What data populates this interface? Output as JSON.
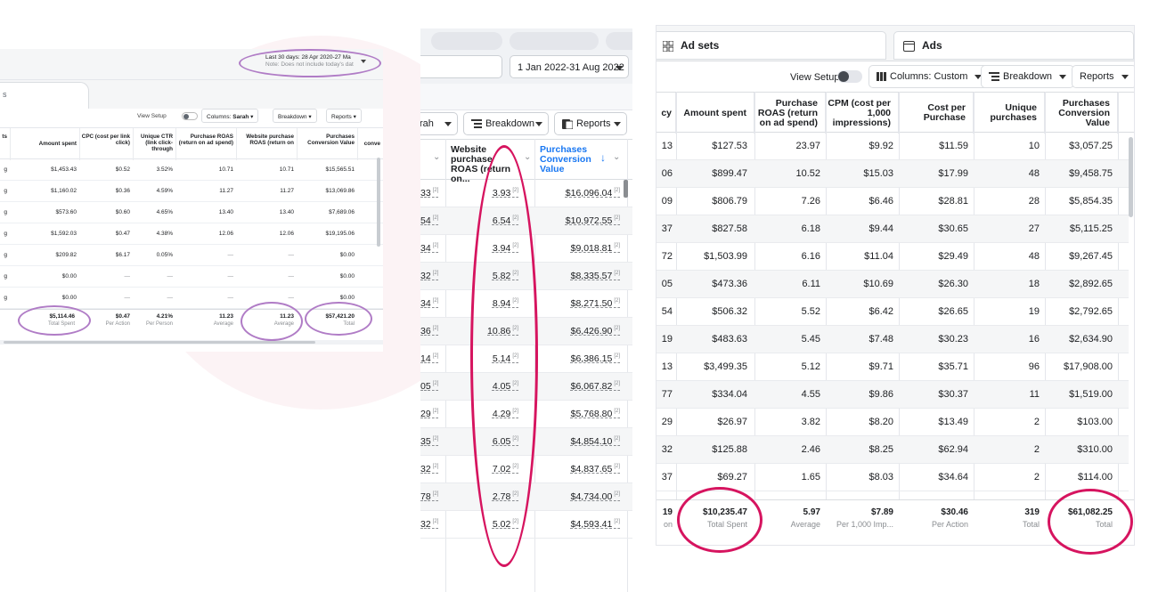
{
  "colors": {
    "highlight_purple": "#b07cc6",
    "highlight_pink": "#d6145f",
    "link_blue": "#1877f2",
    "watermark": "#fbeff2"
  },
  "icons": [
    "toggle-icon",
    "caret-down-icon",
    "columns-icon",
    "breakdown-icon",
    "reports-icon",
    "adsets-icon",
    "ads-icon",
    "sort-desc-icon",
    "info-icon"
  ],
  "panel1": {
    "date_range": "Last 30 days: 28 Apr 2020-27 Ma",
    "date_note": "Note: Does not include today's dat",
    "tab_label": "s",
    "toolbar": {
      "view_setup": "View Setup",
      "columns_prefix": "Columns: ",
      "columns_value": "Sarah",
      "breakdown": "Breakdown",
      "reports": "Reports"
    },
    "headers": [
      "ts",
      "Amount spent",
      "CPC (cost per link click)",
      "Unique CTR (link click-through",
      "Purchase ROAS (return on ad spend)",
      "Website purchase ROAS (return on",
      "Purchases Conversion Value",
      "conve"
    ],
    "rows": [
      {
        "c0": "g",
        "amount": "$1,453.43",
        "cpc": "$0.52",
        "ctr": "3.52%",
        "roas": "10.71",
        "wroas": "10.71",
        "pcv": "$15,565.51"
      },
      {
        "c0": "g",
        "amount": "$1,160.02",
        "cpc": "$0.36",
        "ctr": "4.59%",
        "roas": "11.27",
        "wroas": "11.27",
        "pcv": "$13,069.86"
      },
      {
        "c0": "g",
        "amount": "$573.60",
        "cpc": "$0.60",
        "ctr": "4.65%",
        "roas": "13.40",
        "wroas": "13.40",
        "pcv": "$7,689.06"
      },
      {
        "c0": "g",
        "amount": "$1,592.03",
        "cpc": "$0.47",
        "ctr": "4.38%",
        "roas": "12.06",
        "wroas": "12.06",
        "pcv": "$19,195.06"
      },
      {
        "c0": "g",
        "amount": "$209.82",
        "cpc": "$6.17",
        "ctr": "0.05%",
        "roas": "—",
        "wroas": "—",
        "pcv": "$0.00"
      },
      {
        "c0": "g",
        "amount": "$0.00",
        "cpc": "—",
        "ctr": "—",
        "roas": "—",
        "wroas": "—",
        "pcv": "$0.00"
      },
      {
        "c0": "g",
        "amount": "$0.00",
        "cpc": "—",
        "ctr": "—",
        "roas": "—",
        "wroas": "—",
        "pcv": "$0.00"
      }
    ],
    "totals": {
      "amount": "$5,114.46",
      "amount_label": "Total Spent",
      "cpc": "$0.47",
      "cpc_label": "Per Action",
      "ctr": "4.21%",
      "ctr_label": "Per Person",
      "roas": "11.23",
      "roas_label": "Average",
      "wroas": "11.23",
      "wroas_label": "Average",
      "pcv": "$57,421.20",
      "pcv_label": "Total"
    }
  },
  "panel2": {
    "date_range": "1 Jan 2022-31 Aug 2022",
    "toolbar": {
      "columns_partial": "rah",
      "breakdown": "Breakdown",
      "reports": "Reports"
    },
    "headers": {
      "website_roas": "Website purchase ROAS (return on...",
      "pcv": "Purchases Conversion Value"
    },
    "rows": [
      {
        "left": "33",
        "roas": "3.93",
        "pcv": "$16,096.04"
      },
      {
        "left": "54",
        "roas": "6.54",
        "pcv": "$10,972.55"
      },
      {
        "left": "34",
        "roas": "3.94",
        "pcv": "$9,018.81"
      },
      {
        "left": "32",
        "roas": "5.82",
        "pcv": "$8,335.57"
      },
      {
        "left": "34",
        "roas": "8.94",
        "pcv": "$8,271.50"
      },
      {
        "left": "36",
        "roas": "10.86",
        "pcv": "$6,426.90"
      },
      {
        "left": "14",
        "roas": "5.14",
        "pcv": "$6,386.15"
      },
      {
        "left": "05",
        "roas": "4.05",
        "pcv": "$6,067.82"
      },
      {
        "left": "29",
        "roas": "4.29",
        "pcv": "$5,768.80"
      },
      {
        "left": "35",
        "roas": "6.05",
        "pcv": "$4,854.10"
      },
      {
        "left": "32",
        "roas": "7.02",
        "pcv": "$4,837.65"
      },
      {
        "left": "78",
        "roas": "2.78",
        "pcv": "$4,734.00"
      },
      {
        "left": "32",
        "roas": "5.02",
        "pcv": "$4,593.41"
      }
    ],
    "sup": "[2]"
  },
  "panel3": {
    "tabs": {
      "adsets": "Ad sets",
      "ads": "Ads"
    },
    "toolbar": {
      "view_setup": "View Setup",
      "columns": "Columns: Custom",
      "breakdown": "Breakdown",
      "reports": "Reports"
    },
    "headers": {
      "c0": "cy",
      "amount": "Amount spent",
      "roas": "Purchase ROAS (return on ad spend)",
      "cpm": "CPM (cost per 1,000 impressions)",
      "cpp": "Cost per Purchase",
      "uniq": "Unique purchases",
      "pcv": "Purchases Conversion Value"
    },
    "rows": [
      {
        "c0": "13",
        "amount": "$127.53",
        "roas": "23.97",
        "cpm": "$9.92",
        "cpp": "$11.59",
        "uniq": "10",
        "pcv": "$3,057.25"
      },
      {
        "c0": "06",
        "amount": "$899.47",
        "roas": "10.52",
        "cpm": "$15.03",
        "cpp": "$17.99",
        "uniq": "48",
        "pcv": "$9,458.75"
      },
      {
        "c0": "09",
        "amount": "$806.79",
        "roas": "7.26",
        "cpm": "$6.46",
        "cpp": "$28.81",
        "uniq": "28",
        "pcv": "$5,854.35"
      },
      {
        "c0": "37",
        "amount": "$827.58",
        "roas": "6.18",
        "cpm": "$9.44",
        "cpp": "$30.65",
        "uniq": "27",
        "pcv": "$5,115.25"
      },
      {
        "c0": "72",
        "amount": "$1,503.99",
        "roas": "6.16",
        "cpm": "$11.04",
        "cpp": "$29.49",
        "uniq": "48",
        "pcv": "$9,267.45"
      },
      {
        "c0": "05",
        "amount": "$473.36",
        "roas": "6.11",
        "cpm": "$10.69",
        "cpp": "$26.30",
        "uniq": "18",
        "pcv": "$2,892.65"
      },
      {
        "c0": "54",
        "amount": "$506.32",
        "roas": "5.52",
        "cpm": "$6.42",
        "cpp": "$26.65",
        "uniq": "19",
        "pcv": "$2,792.65"
      },
      {
        "c0": "19",
        "amount": "$483.63",
        "roas": "5.45",
        "cpm": "$7.48",
        "cpp": "$30.23",
        "uniq": "16",
        "pcv": "$2,634.90"
      },
      {
        "c0": "13",
        "amount": "$3,499.35",
        "roas": "5.12",
        "cpm": "$9.71",
        "cpp": "$35.71",
        "uniq": "96",
        "pcv": "$17,908.00"
      },
      {
        "c0": "77",
        "amount": "$334.04",
        "roas": "4.55",
        "cpm": "$9.86",
        "cpp": "$30.37",
        "uniq": "11",
        "pcv": "$1,519.00"
      },
      {
        "c0": "29",
        "amount": "$26.97",
        "roas": "3.82",
        "cpm": "$8.20",
        "cpp": "$13.49",
        "uniq": "2",
        "pcv": "$103.00"
      },
      {
        "c0": "32",
        "amount": "$125.88",
        "roas": "2.46",
        "cpm": "$8.25",
        "cpp": "$62.94",
        "uniq": "2",
        "pcv": "$310.00"
      },
      {
        "c0": "37",
        "amount": "$69.27",
        "roas": "1.65",
        "cpm": "$8.03",
        "cpp": "$34.64",
        "uniq": "2",
        "pcv": "$114.00"
      }
    ],
    "totals": {
      "c0": "19",
      "c0_label": "on",
      "amount": "$10,235.47",
      "amount_label": "Total Spent",
      "roas": "5.97",
      "roas_label": "Average",
      "cpm": "$7.89",
      "cpm_label": "Per 1,000 Imp...",
      "cpp": "$30.46",
      "cpp_label": "Per Action",
      "uniq": "319",
      "uniq_label": "Total",
      "pcv": "$61,082.25",
      "pcv_label": "Total"
    }
  }
}
